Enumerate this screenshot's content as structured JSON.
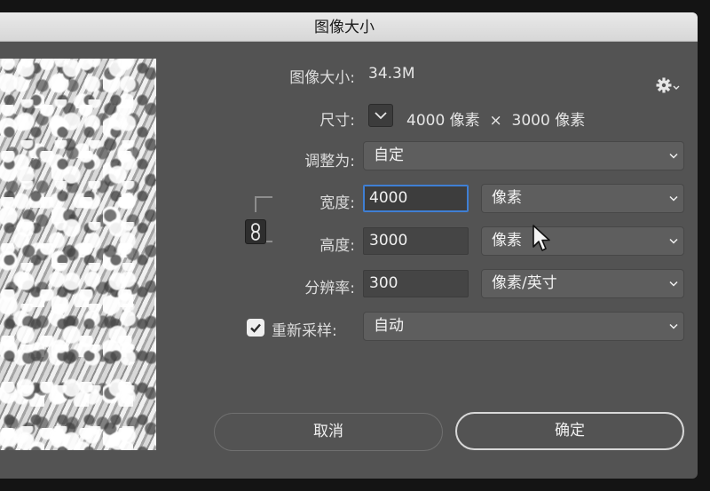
{
  "dialog": {
    "title": "图像大小",
    "image_size_label": "图像大小:",
    "image_size_value": "34.3M",
    "dimensions_label": "尺寸:",
    "dimensions_value": "4000 像素  ×  3000 像素",
    "fit_to_label": "调整为:",
    "fit_to_value": "自定",
    "width_label": "宽度:",
    "width_value": "4000",
    "width_unit": "像素",
    "height_label": "高度:",
    "height_value": "3000",
    "height_unit": "像素",
    "resolution_label": "分辨率:",
    "resolution_value": "300",
    "resolution_unit": "像素/英寸",
    "resample_label": "重新采样:",
    "resample_checked": true,
    "resample_value": "自动",
    "cancel_label": "取消",
    "ok_label": "确定"
  },
  "icons": {
    "settings": "gear-icon",
    "dropdown": "chevron-down-icon",
    "link": "chain-link-icon",
    "check": "checkmark-icon",
    "pointer": "mouse-cursor-icon"
  },
  "colors": {
    "dialog_bg": "#535353",
    "titlebar_bg": "#e0e0e0",
    "focus_border": "#3f7fd4",
    "label_text": "#dcdcdc"
  }
}
